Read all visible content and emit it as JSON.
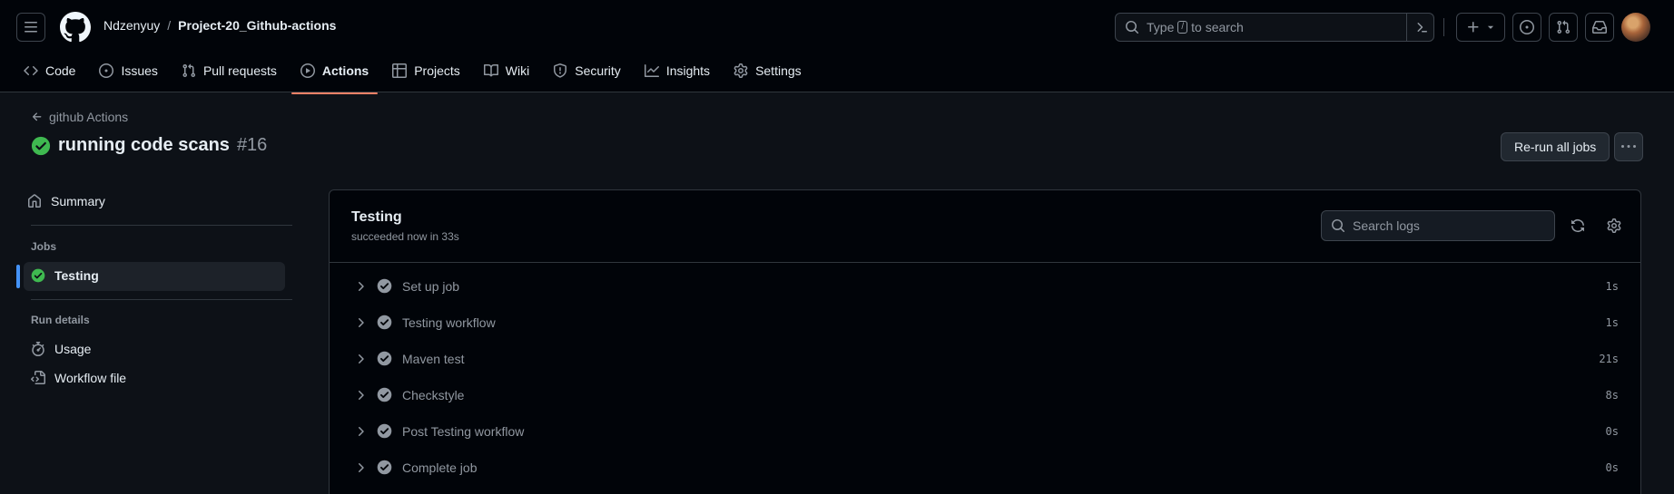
{
  "header": {
    "owner": "Ndzenyuy",
    "separator": "/",
    "repo": "Project-20_Github-actions",
    "search_prefix": "Type",
    "search_key": "/",
    "search_suffix": "to search"
  },
  "nav": {
    "items": [
      {
        "label": "Code",
        "icon": "code-icon"
      },
      {
        "label": "Issues",
        "icon": "issue-opened-icon"
      },
      {
        "label": "Pull requests",
        "icon": "git-pull-request-icon"
      },
      {
        "label": "Actions",
        "icon": "play-icon",
        "active": true
      },
      {
        "label": "Projects",
        "icon": "table-icon"
      },
      {
        "label": "Wiki",
        "icon": "book-icon"
      },
      {
        "label": "Security",
        "icon": "shield-icon"
      },
      {
        "label": "Insights",
        "icon": "graph-icon"
      },
      {
        "label": "Settings",
        "icon": "gear-icon"
      }
    ]
  },
  "run": {
    "back_label": "github Actions",
    "title": "running code scans",
    "number": "#16",
    "rerun_label": "Re-run all jobs"
  },
  "sidebar": {
    "summary": "Summary",
    "jobs_heading": "Jobs",
    "job": "Testing",
    "run_details_heading": "Run details",
    "usage": "Usage",
    "workflow_file": "Workflow file"
  },
  "job": {
    "title": "Testing",
    "subtitle": "succeeded now in 33s",
    "search_placeholder": "Search logs",
    "steps": [
      {
        "name": "Set up job",
        "duration": "1s"
      },
      {
        "name": "Testing workflow",
        "duration": "1s"
      },
      {
        "name": "Maven test",
        "duration": "21s"
      },
      {
        "name": "Checkstyle",
        "duration": "8s"
      },
      {
        "name": "Post Testing workflow",
        "duration": "0s"
      },
      {
        "name": "Complete job",
        "duration": "0s"
      }
    ]
  },
  "colors": {
    "success": "#3fb950",
    "accent_underline": "#f78166",
    "selected_bar": "#4493f8"
  }
}
